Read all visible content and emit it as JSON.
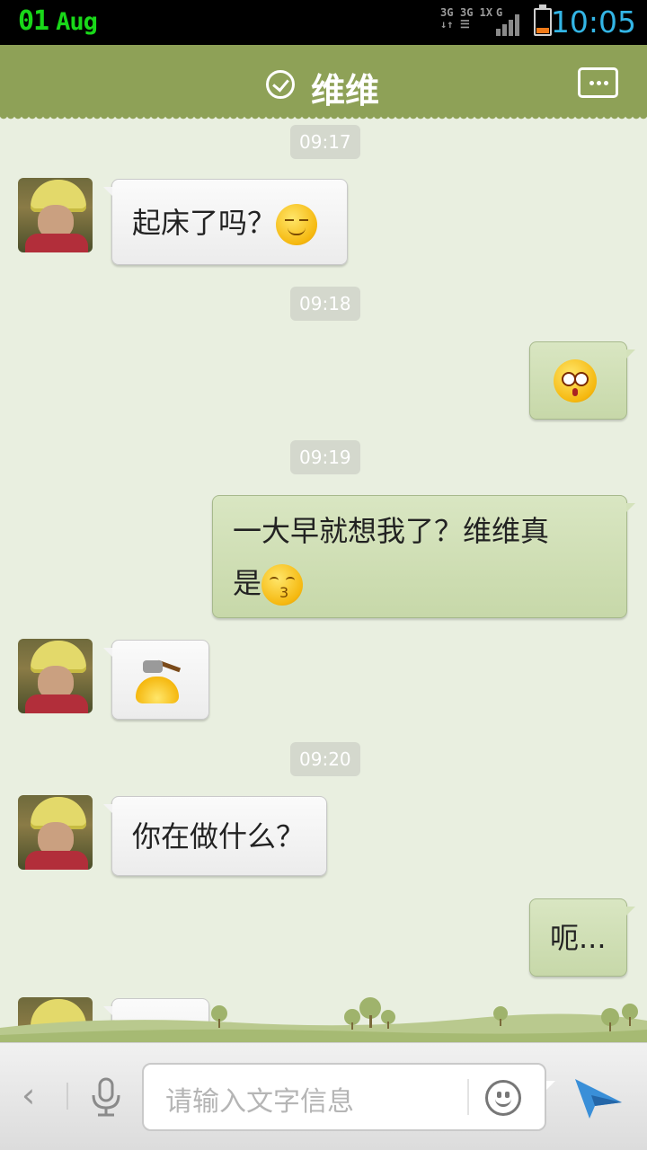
{
  "status_bar": {
    "date_day": "01",
    "date_month": "Aug",
    "net_labels": [
      "3G",
      "3G 1X",
      "G"
    ],
    "time": "10:05"
  },
  "header": {
    "title": "维维",
    "verified_icon": "check-circle-icon",
    "more_icon": "more-icon"
  },
  "messages": [
    {
      "type": "time",
      "text": "09:17"
    },
    {
      "type": "incoming",
      "text": "起床了吗？",
      "emoji": "smile-emoji"
    },
    {
      "type": "time",
      "text": "09:18"
    },
    {
      "type": "outgoing",
      "emoji": "angry-emoji"
    },
    {
      "type": "time",
      "text": "09:19"
    },
    {
      "type": "outgoing",
      "text_line1": "一大早就想我了？维维真",
      "text_line2": "是",
      "emoji": "kiss-emoji"
    },
    {
      "type": "incoming",
      "emoji": "hammer-emoji"
    },
    {
      "type": "time",
      "text": "09:20"
    },
    {
      "type": "incoming",
      "text": "你在做什么？"
    },
    {
      "type": "outgoing",
      "text": "呃..."
    },
    {
      "type": "incoming",
      "text": "?"
    }
  ],
  "input_bar": {
    "back_icon": "chevron-left-icon",
    "back_glyph": "‹",
    "mic_icon": "microphone-icon",
    "placeholder": "请输入文字信息",
    "emoji_icon": "smiley-icon",
    "send_icon": "send-icon"
  },
  "colors": {
    "header_bg": "#8ea157",
    "chat_bg": "#e9efe0",
    "outgoing_bubble": "#d0dfb5",
    "incoming_bubble": "#f3f3f3",
    "time_accent": "#33b5e5",
    "date_accent": "#19d819"
  }
}
